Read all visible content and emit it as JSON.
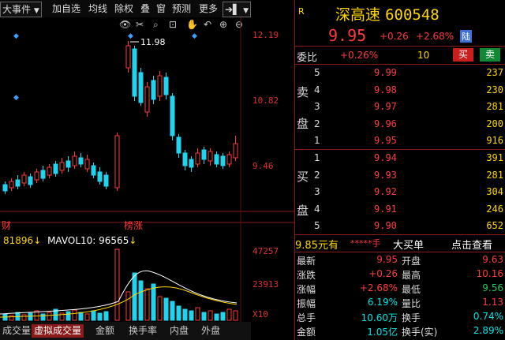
{
  "toolbar": {
    "items": [
      "大事件",
      "加自选",
      "均线",
      "除权",
      "叠",
      "窗",
      "预测",
      "更多"
    ],
    "pin_icon": "pin-icon",
    "dropdown_icon": "chevron-down-icon"
  },
  "chart_tools": [
    "eye-icon",
    "scissors-icon",
    "search-icon",
    "hand-icon",
    "undo-icon",
    "zoom-in-icon",
    "zoom-out-icon"
  ],
  "price_axis": [
    "12.19",
    "10.82",
    "9.46"
  ],
  "high_marker": "11.98",
  "markers": [
    "财",
    "榜涨"
  ],
  "volume_header": {
    "vol": "81896",
    "mavol_label": "MAVOL10:",
    "mavol_value": "96565"
  },
  "volume_axis": [
    "47257",
    "23913",
    "X10"
  ],
  "bottom_tabs": [
    "成交量",
    "虚拟成交量",
    "金额",
    "换手率",
    "内盘",
    "外盘"
  ],
  "stock": {
    "flag": "R",
    "name": "深高速",
    "code": "600548",
    "price": "9.95",
    "change": "+0.26",
    "change_pct": "+2.68%",
    "market_tag": "陆"
  },
  "committee": {
    "label": "委比",
    "ratio": "+0.26%",
    "diff": "10",
    "buy_label": "买",
    "sell_label": "卖"
  },
  "sell_label_chars": [
    "卖",
    "盘"
  ],
  "buy_label_chars": [
    "买",
    "盘"
  ],
  "asks": [
    {
      "n": "5",
      "p": "9.99",
      "v": "237"
    },
    {
      "n": "4",
      "p": "9.98",
      "v": "230"
    },
    {
      "n": "3",
      "p": "9.97",
      "v": "281"
    },
    {
      "n": "2",
      "p": "9.96",
      "v": "200"
    },
    {
      "n": "1",
      "p": "9.95",
      "v": "916"
    }
  ],
  "bids": [
    {
      "n": "1",
      "p": "9.94",
      "v": "391"
    },
    {
      "n": "2",
      "p": "9.93",
      "v": "281"
    },
    {
      "n": "3",
      "p": "9.92",
      "v": "304"
    },
    {
      "n": "4",
      "p": "9.91",
      "v": "246"
    },
    {
      "n": "5",
      "p": "9.90",
      "v": "652"
    }
  ],
  "trade_bar": {
    "price_label": "9.85元有",
    "stars": "*****手",
    "big_buy": "大买单",
    "click_view": "点击查看"
  },
  "stats": {
    "latest": {
      "label": "最新",
      "value": "9.95"
    },
    "open": {
      "label": "开盘",
      "value": "9.63"
    },
    "change": {
      "label": "涨跌",
      "value": "+0.26"
    },
    "high": {
      "label": "最高",
      "value": "10.16"
    },
    "pct": {
      "label": "涨幅",
      "value": "+2.68%"
    },
    "low": {
      "label": "最低",
      "value": "9.56"
    },
    "amplitude": {
      "label": "振幅",
      "value": "6.19%"
    },
    "vol_ratio": {
      "label": "量比",
      "value": "1.13"
    },
    "total_hands": {
      "label": "总手",
      "value": "10.60万"
    },
    "turnover": {
      "label": "换手",
      "value": "0.74%"
    },
    "amount": {
      "label": "金额",
      "value": "1.05亿"
    },
    "turnover_real": {
      "label": "换手(实)",
      "value": "2.89%"
    }
  },
  "colors": {
    "up": "#ff3b3b",
    "down": "#22d3ee",
    "accent": "#ffd700",
    "border": "#8b1a1a"
  }
}
